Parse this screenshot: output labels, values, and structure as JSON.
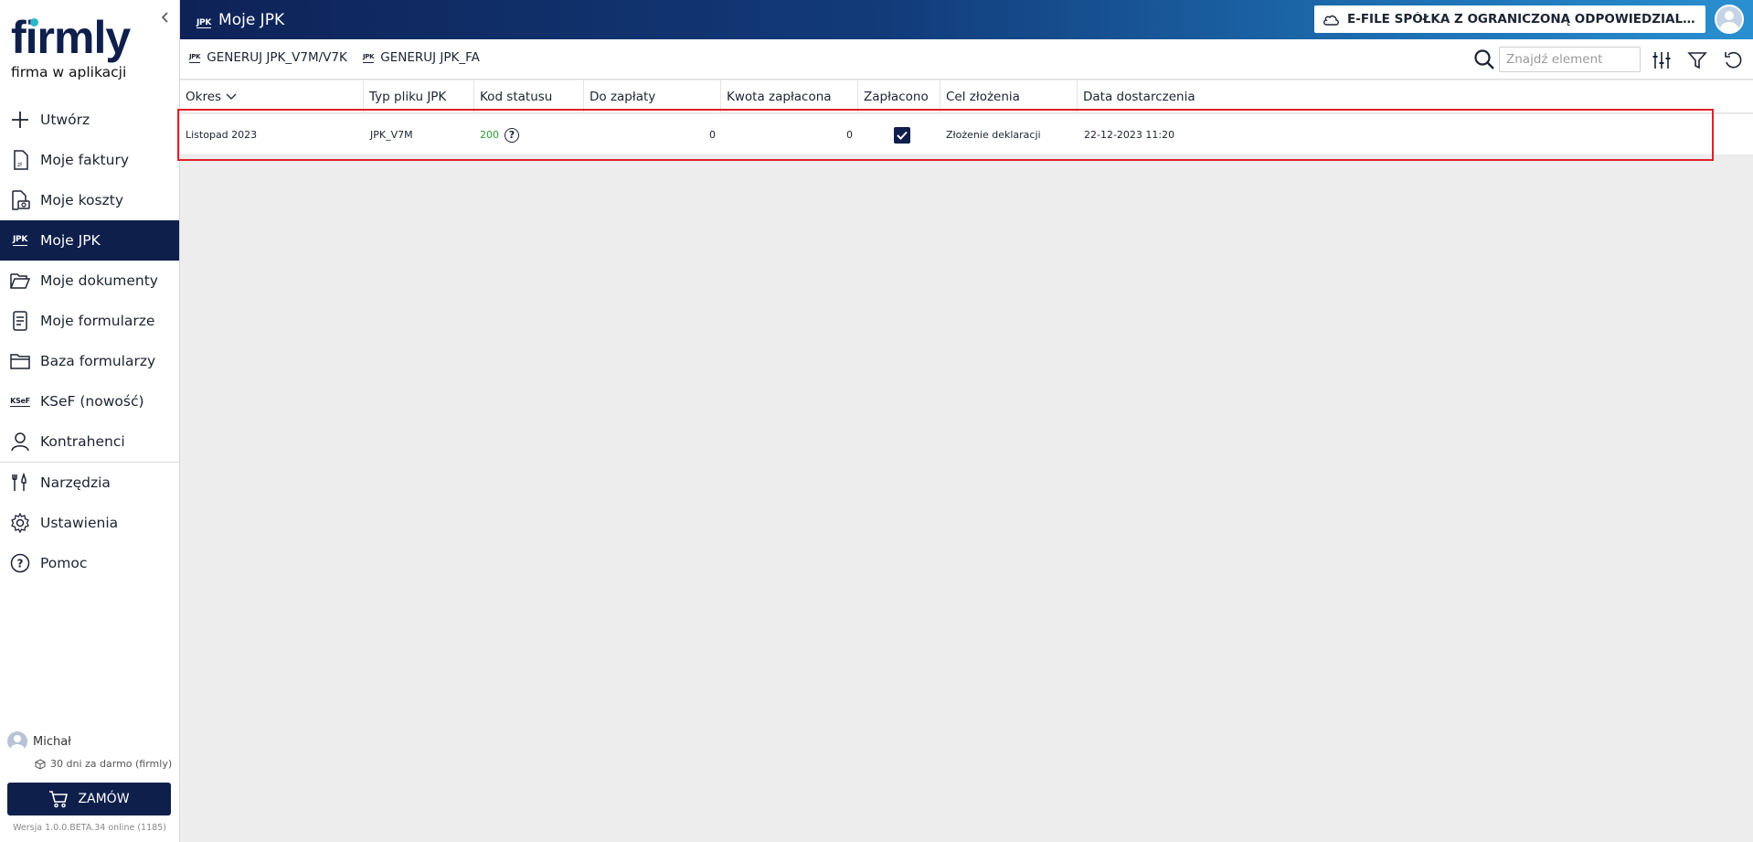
{
  "app": {
    "logo_text": "firmly",
    "tagline": "firma w aplikacji",
    "collapse_icon": "chevron-left-icon"
  },
  "header": {
    "page_badge": "JPK",
    "title": "Moje JPK",
    "company": "E-FILE SPÓŁKA Z OGRANICZONĄ ODPOWIEDZIALNOŚCIĄ",
    "company_icon": "cloud-icon"
  },
  "sidebar": {
    "items": [
      {
        "label": "Utwórz",
        "icon": "plus-icon"
      },
      {
        "label": "Moje faktury",
        "icon": "invoice-icon"
      },
      {
        "label": "Moje koszty",
        "icon": "costs-icon"
      },
      {
        "label": "Moje JPK",
        "icon": "jpk-icon",
        "badge": "JPK",
        "active": true
      },
      {
        "label": "Moje dokumenty",
        "icon": "folder-open-icon"
      },
      {
        "label": "Moje formularze",
        "icon": "form-icon"
      },
      {
        "label": "Baza formularzy",
        "icon": "folder-icon"
      },
      {
        "label": "KSeF (nowość)",
        "icon": "ksef-icon",
        "badge": "KSeF"
      },
      {
        "label": "Kontrahenci",
        "icon": "person-icon"
      },
      {
        "label": "Narzędzia",
        "icon": "tools-icon"
      },
      {
        "label": "Ustawienia",
        "icon": "gear-icon"
      },
      {
        "label": "Pomoc",
        "icon": "help-icon"
      }
    ],
    "user_name": "Michał",
    "trial_text": "30 dni za darmo (firmly)",
    "order_label": "ZAMÓW",
    "version": "Wersja 1.0.0.BETA.34 online (1185)"
  },
  "toolbar": {
    "generate_v7": "GENERUJ JPK_V7M/V7K",
    "generate_fa": "GENERUJ JPK_FA",
    "badge": "JPK",
    "search_placeholder": "Znajdź element"
  },
  "table": {
    "columns": [
      "Okres",
      "Typ pliku JPK",
      "Kod statusu",
      "Do zapłaty",
      "Kwota zapłacona",
      "Zapłacono",
      "Cel złożenia",
      "Data dostarczenia"
    ],
    "rows": [
      {
        "okres": "Listopad 2023",
        "typ": "JPK_V7M",
        "kod": "200",
        "do_zaplaty": "0",
        "kwota_zaplacona": "0",
        "zaplacono": true,
        "cel": "Złożenie deklaracji",
        "data": "22-12-2023 11:20"
      }
    ]
  },
  "colors": {
    "navy": "#0f1f4b",
    "accent_teal": "#2bb6c9",
    "status_ok": "#2f9a3a",
    "highlight": "#e0202a"
  }
}
